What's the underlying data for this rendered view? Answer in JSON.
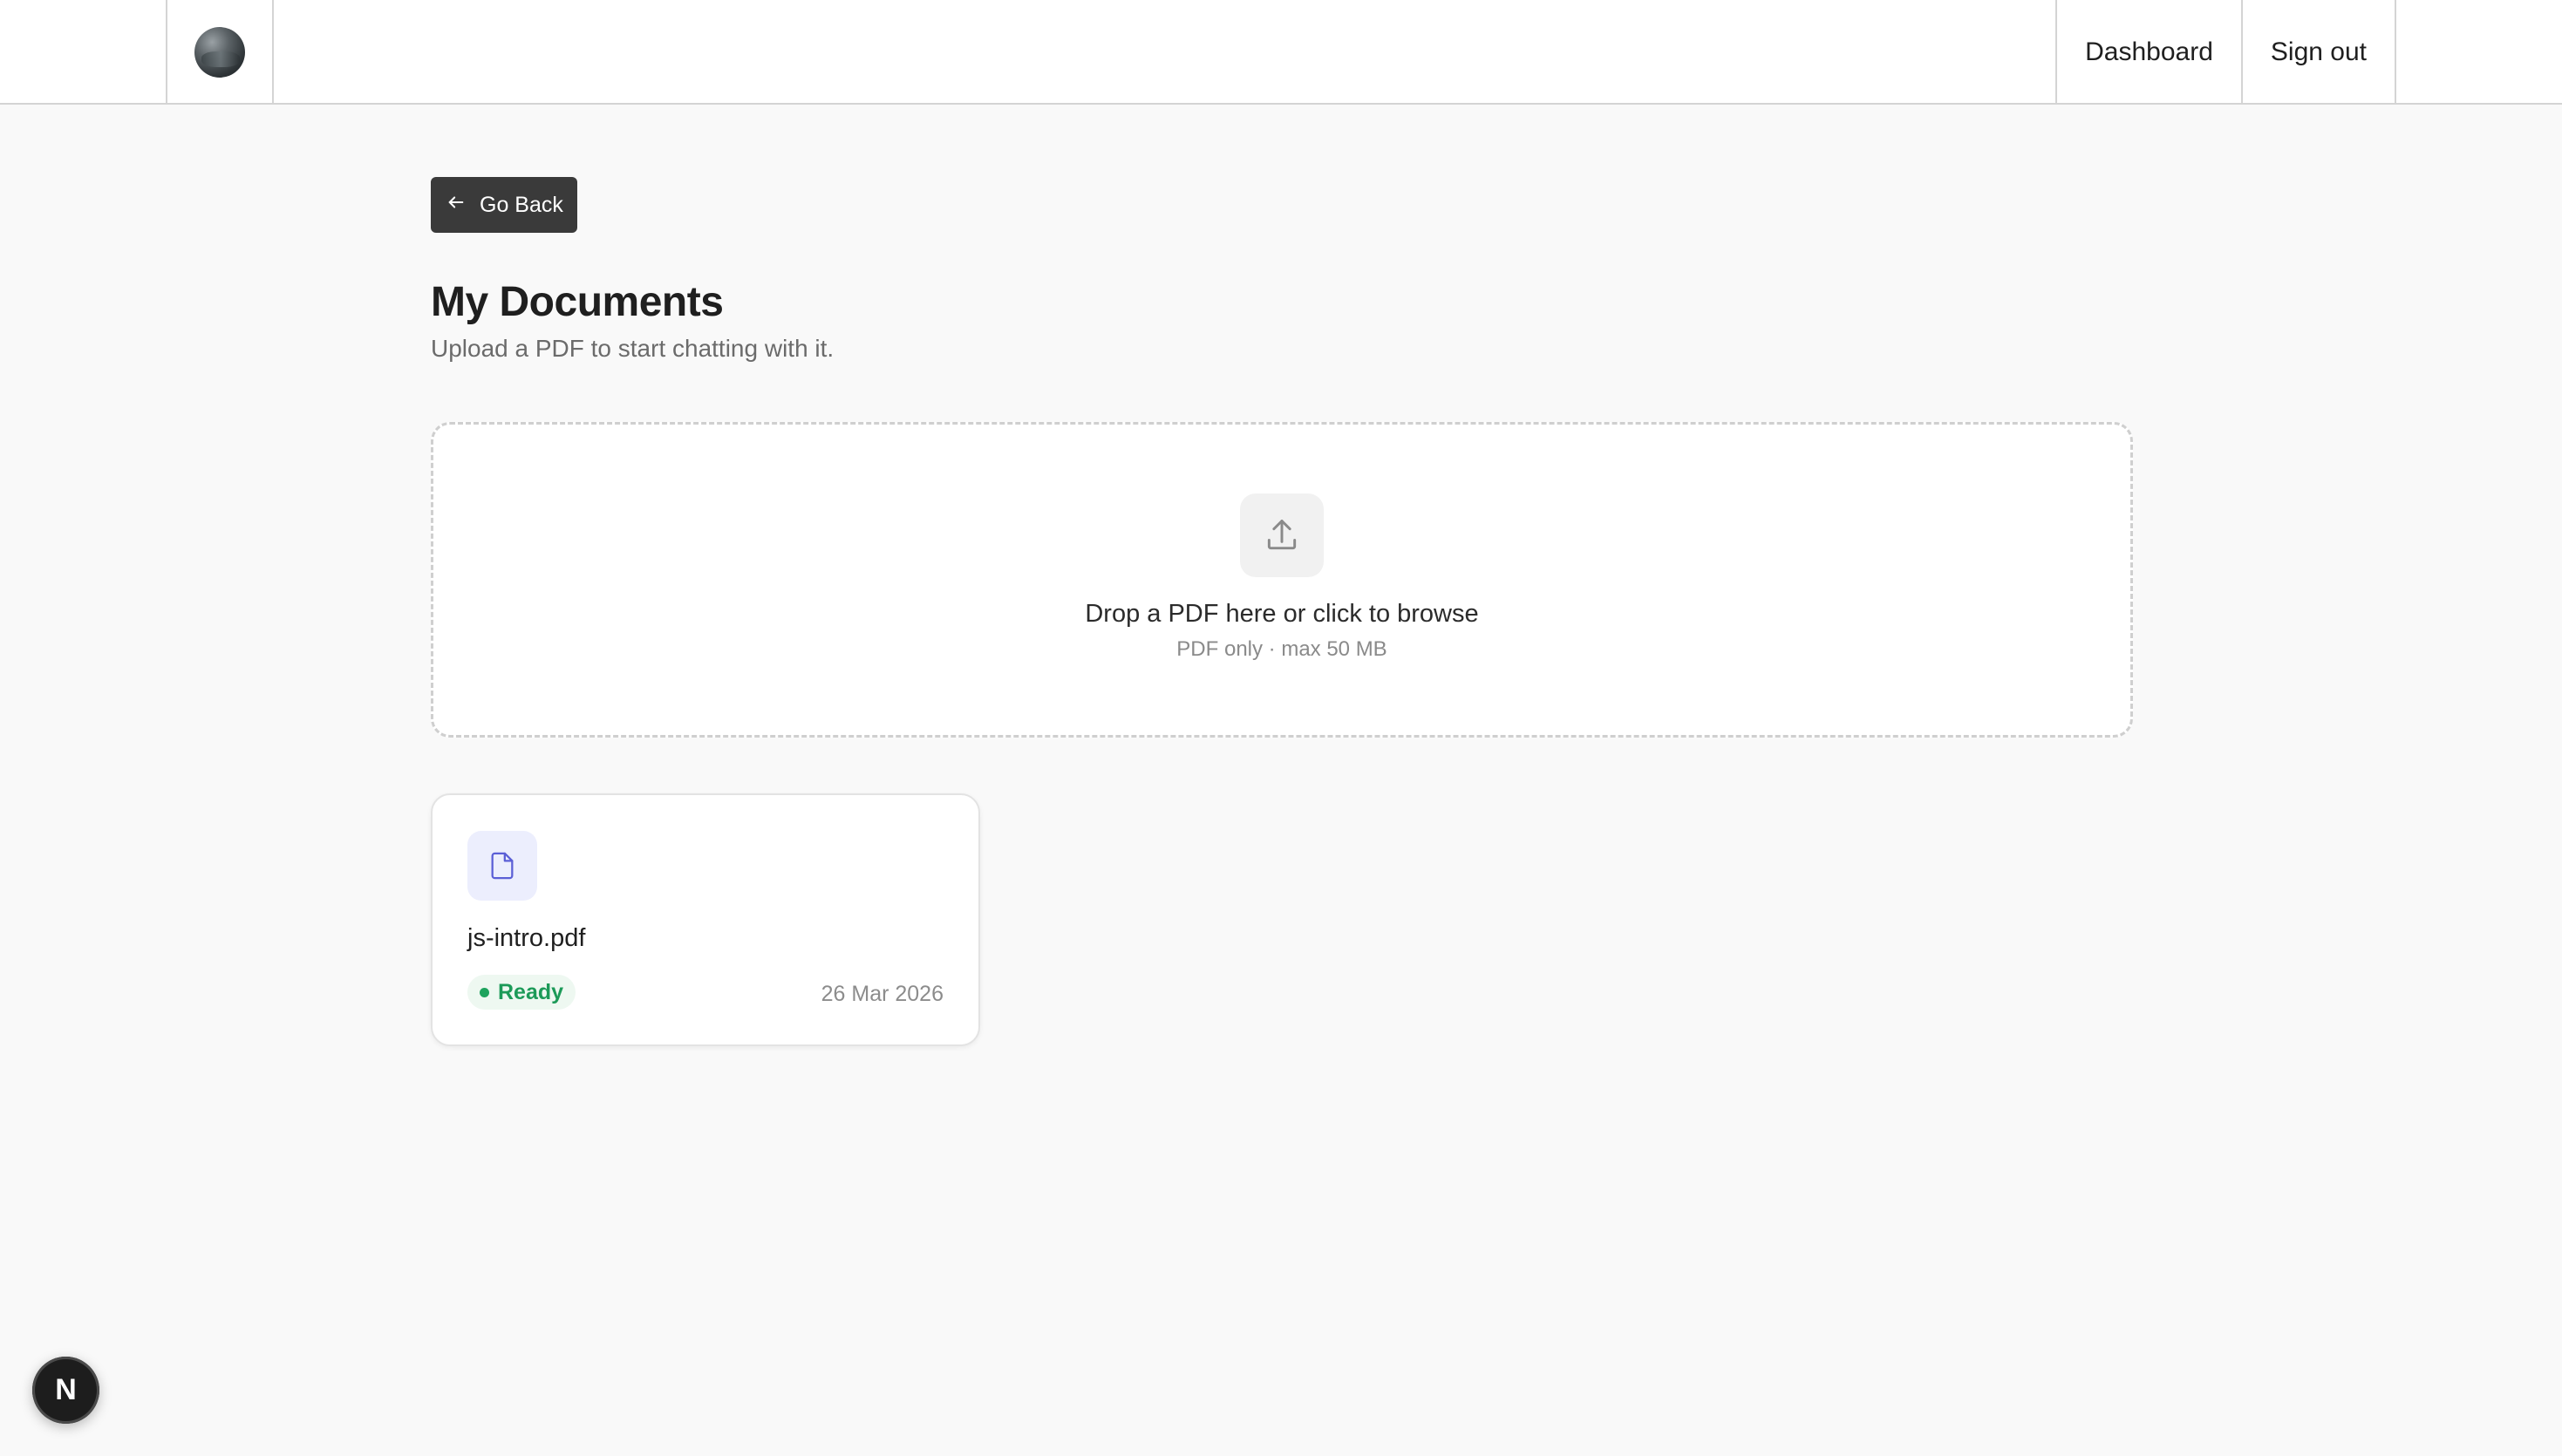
{
  "header": {
    "nav": [
      {
        "label": "Dashboard"
      },
      {
        "label": "Sign out"
      }
    ]
  },
  "main": {
    "back_label": "Go Back",
    "title": "My Documents",
    "subtitle": "Upload a PDF to start chatting with it.",
    "dropzone": {
      "title": "Drop a PDF here or click to browse",
      "hint": "PDF only · max 50 MB",
      "icon": "upload-icon"
    },
    "documents": [
      {
        "name": "js-intro.pdf",
        "status": "Ready",
        "date": "26 Mar 2026",
        "icon": "file-icon"
      }
    ]
  },
  "dev_badge": {
    "letter": "N"
  },
  "colors": {
    "status_ready": "#1c9a58",
    "doc_icon_bg": "#eceefd",
    "doc_icon_stroke": "#5b5fd6",
    "button_dark": "#3a3a3a"
  }
}
